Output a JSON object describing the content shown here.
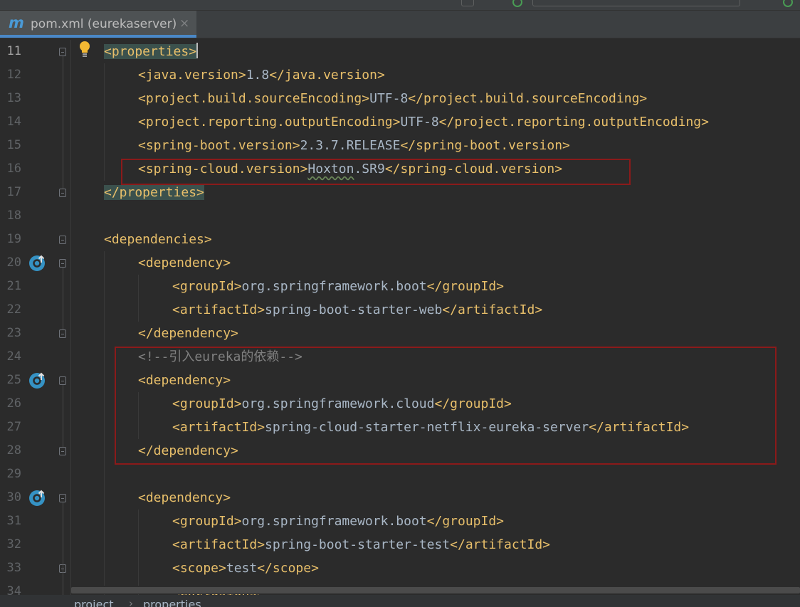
{
  "tab": {
    "icon": "maven-icon",
    "icon_glyph": "m",
    "label": "pom.xml (eurekaserver)",
    "close": "×"
  },
  "lines": [
    {
      "num": "11",
      "segments": [
        {
          "cls": "tag hl",
          "text": "<properties>"
        }
      ]
    },
    {
      "num": "12",
      "segments": [
        {
          "cls": "tag",
          "text": "<java.version>"
        },
        {
          "cls": "txt",
          "text": "1.8"
        },
        {
          "cls": "tag",
          "text": "</java.version>"
        }
      ]
    },
    {
      "num": "13",
      "segments": [
        {
          "cls": "tag",
          "text": "<project.build.sourceEncoding>"
        },
        {
          "cls": "txt",
          "text": "UTF-8"
        },
        {
          "cls": "tag",
          "text": "</project.build.sourceEncoding>"
        }
      ]
    },
    {
      "num": "14",
      "segments": [
        {
          "cls": "tag",
          "text": "<project.reporting.outputEncoding>"
        },
        {
          "cls": "txt",
          "text": "UTF-8"
        },
        {
          "cls": "tag",
          "text": "</project.reporting.outputEncoding>"
        }
      ]
    },
    {
      "num": "15",
      "segments": [
        {
          "cls": "tag",
          "text": "<spring-boot.version>"
        },
        {
          "cls": "txt",
          "text": "2.3.7.RELEASE"
        },
        {
          "cls": "tag",
          "text": "</spring-boot.version>"
        }
      ]
    },
    {
      "num": "16",
      "segments": [
        {
          "cls": "tag",
          "text": "<spring-cloud.version>"
        },
        {
          "cls": "txt squig",
          "text": "Hoxton"
        },
        {
          "cls": "txt",
          "text": ".SR9"
        },
        {
          "cls": "tag",
          "text": "</spring-cloud.version>"
        }
      ]
    },
    {
      "num": "17",
      "segments": [
        {
          "cls": "tag hl",
          "text": "</properties>"
        }
      ]
    },
    {
      "num": "18",
      "segments": []
    },
    {
      "num": "19",
      "segments": [
        {
          "cls": "tag",
          "text": "<dependencies>"
        }
      ]
    },
    {
      "num": "20",
      "segments": [
        {
          "cls": "tag",
          "text": "<dependency>"
        }
      ]
    },
    {
      "num": "21",
      "segments": [
        {
          "cls": "tag",
          "text": "<groupId>"
        },
        {
          "cls": "txt",
          "text": "org.springframework.boot"
        },
        {
          "cls": "tag",
          "text": "</groupId>"
        }
      ]
    },
    {
      "num": "22",
      "segments": [
        {
          "cls": "tag",
          "text": "<artifactId>"
        },
        {
          "cls": "txt",
          "text": "spring-boot-starter-web"
        },
        {
          "cls": "tag",
          "text": "</artifactId>"
        }
      ]
    },
    {
      "num": "23",
      "segments": [
        {
          "cls": "tag",
          "text": "</dependency>"
        }
      ]
    },
    {
      "num": "24",
      "segments": [
        {
          "cls": "cmt",
          "text": "<!--引入eureka的依赖-->"
        }
      ]
    },
    {
      "num": "25",
      "segments": [
        {
          "cls": "tag",
          "text": "<dependency>"
        }
      ]
    },
    {
      "num": "26",
      "segments": [
        {
          "cls": "tag",
          "text": "<groupId>"
        },
        {
          "cls": "txt",
          "text": "org.springframework.cloud"
        },
        {
          "cls": "tag",
          "text": "</groupId>"
        }
      ]
    },
    {
      "num": "27",
      "segments": [
        {
          "cls": "tag",
          "text": "<artifactId>"
        },
        {
          "cls": "txt",
          "text": "spring-cloud-starter-netflix-eureka-server"
        },
        {
          "cls": "tag",
          "text": "</artifactId>"
        }
      ]
    },
    {
      "num": "28",
      "segments": [
        {
          "cls": "tag",
          "text": "</dependency>"
        }
      ]
    },
    {
      "num": "29",
      "segments": []
    },
    {
      "num": "30",
      "segments": [
        {
          "cls": "tag",
          "text": "<dependency>"
        }
      ]
    },
    {
      "num": "31",
      "segments": [
        {
          "cls": "tag",
          "text": "<groupId>"
        },
        {
          "cls": "txt",
          "text": "org.springframework.boot"
        },
        {
          "cls": "tag",
          "text": "</groupId>"
        }
      ]
    },
    {
      "num": "32",
      "segments": [
        {
          "cls": "tag",
          "text": "<artifactId>"
        },
        {
          "cls": "txt",
          "text": "spring-boot-starter-test"
        },
        {
          "cls": "tag",
          "text": "</artifactId>"
        }
      ]
    },
    {
      "num": "33",
      "segments": [
        {
          "cls": "tag",
          "text": "<scope>"
        },
        {
          "cls": "txt",
          "text": "test"
        },
        {
          "cls": "tag",
          "text": "</scope>"
        }
      ]
    },
    {
      "num": "34",
      "segments": [
        {
          "cls": "tag",
          "text": "<exclusions>"
        }
      ]
    }
  ],
  "breadcrumb": {
    "items": [
      "project",
      "properties"
    ],
    "separator": "›"
  },
  "colors": {
    "background": "#2b2b2b",
    "tag": "#e8bf6a",
    "text": "#a9b7c6",
    "comment": "#808080",
    "highlight_box": "#8b1a1a",
    "tab_accent": "#4a88c7"
  }
}
